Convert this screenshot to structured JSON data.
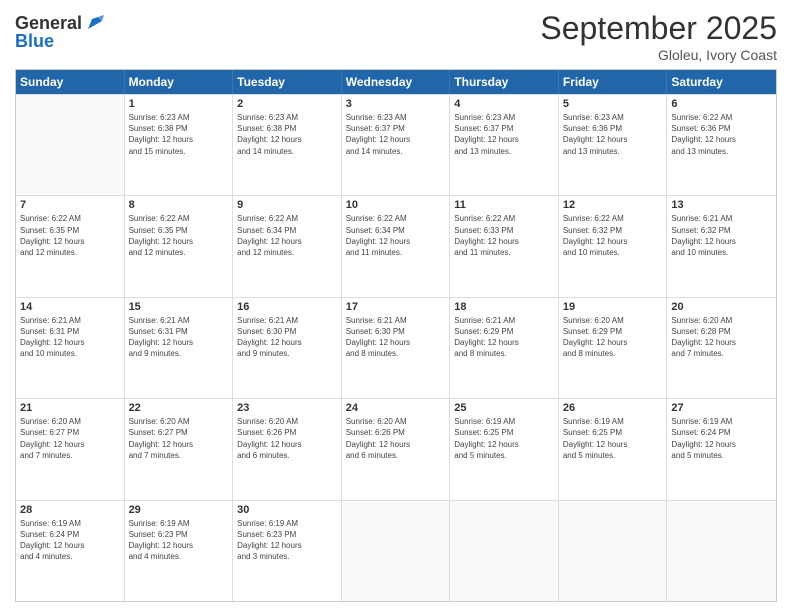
{
  "header": {
    "logo_general": "General",
    "logo_blue": "Blue",
    "month": "September 2025",
    "location": "Gloleu, Ivory Coast"
  },
  "weekdays": [
    "Sunday",
    "Monday",
    "Tuesday",
    "Wednesday",
    "Thursday",
    "Friday",
    "Saturday"
  ],
  "rows": [
    [
      {
        "day": "",
        "info": ""
      },
      {
        "day": "1",
        "info": "Sunrise: 6:23 AM\nSunset: 6:38 PM\nDaylight: 12 hours\nand 15 minutes."
      },
      {
        "day": "2",
        "info": "Sunrise: 6:23 AM\nSunset: 6:38 PM\nDaylight: 12 hours\nand 14 minutes."
      },
      {
        "day": "3",
        "info": "Sunrise: 6:23 AM\nSunset: 6:37 PM\nDaylight: 12 hours\nand 14 minutes."
      },
      {
        "day": "4",
        "info": "Sunrise: 6:23 AM\nSunset: 6:37 PM\nDaylight: 12 hours\nand 13 minutes."
      },
      {
        "day": "5",
        "info": "Sunrise: 6:23 AM\nSunset: 6:36 PM\nDaylight: 12 hours\nand 13 minutes."
      },
      {
        "day": "6",
        "info": "Sunrise: 6:22 AM\nSunset: 6:36 PM\nDaylight: 12 hours\nand 13 minutes."
      }
    ],
    [
      {
        "day": "7",
        "info": "Sunrise: 6:22 AM\nSunset: 6:35 PM\nDaylight: 12 hours\nand 12 minutes."
      },
      {
        "day": "8",
        "info": "Sunrise: 6:22 AM\nSunset: 6:35 PM\nDaylight: 12 hours\nand 12 minutes."
      },
      {
        "day": "9",
        "info": "Sunrise: 6:22 AM\nSunset: 6:34 PM\nDaylight: 12 hours\nand 12 minutes."
      },
      {
        "day": "10",
        "info": "Sunrise: 6:22 AM\nSunset: 6:34 PM\nDaylight: 12 hours\nand 11 minutes."
      },
      {
        "day": "11",
        "info": "Sunrise: 6:22 AM\nSunset: 6:33 PM\nDaylight: 12 hours\nand 11 minutes."
      },
      {
        "day": "12",
        "info": "Sunrise: 6:22 AM\nSunset: 6:32 PM\nDaylight: 12 hours\nand 10 minutes."
      },
      {
        "day": "13",
        "info": "Sunrise: 6:21 AM\nSunset: 6:32 PM\nDaylight: 12 hours\nand 10 minutes."
      }
    ],
    [
      {
        "day": "14",
        "info": "Sunrise: 6:21 AM\nSunset: 6:31 PM\nDaylight: 12 hours\nand 10 minutes."
      },
      {
        "day": "15",
        "info": "Sunrise: 6:21 AM\nSunset: 6:31 PM\nDaylight: 12 hours\nand 9 minutes."
      },
      {
        "day": "16",
        "info": "Sunrise: 6:21 AM\nSunset: 6:30 PM\nDaylight: 12 hours\nand 9 minutes."
      },
      {
        "day": "17",
        "info": "Sunrise: 6:21 AM\nSunset: 6:30 PM\nDaylight: 12 hours\nand 8 minutes."
      },
      {
        "day": "18",
        "info": "Sunrise: 6:21 AM\nSunset: 6:29 PM\nDaylight: 12 hours\nand 8 minutes."
      },
      {
        "day": "19",
        "info": "Sunrise: 6:20 AM\nSunset: 6:29 PM\nDaylight: 12 hours\nand 8 minutes."
      },
      {
        "day": "20",
        "info": "Sunrise: 6:20 AM\nSunset: 6:28 PM\nDaylight: 12 hours\nand 7 minutes."
      }
    ],
    [
      {
        "day": "21",
        "info": "Sunrise: 6:20 AM\nSunset: 6:27 PM\nDaylight: 12 hours\nand 7 minutes."
      },
      {
        "day": "22",
        "info": "Sunrise: 6:20 AM\nSunset: 6:27 PM\nDaylight: 12 hours\nand 7 minutes."
      },
      {
        "day": "23",
        "info": "Sunrise: 6:20 AM\nSunset: 6:26 PM\nDaylight: 12 hours\nand 6 minutes."
      },
      {
        "day": "24",
        "info": "Sunrise: 6:20 AM\nSunset: 6:26 PM\nDaylight: 12 hours\nand 6 minutes."
      },
      {
        "day": "25",
        "info": "Sunrise: 6:19 AM\nSunset: 6:25 PM\nDaylight: 12 hours\nand 5 minutes."
      },
      {
        "day": "26",
        "info": "Sunrise: 6:19 AM\nSunset: 6:25 PM\nDaylight: 12 hours\nand 5 minutes."
      },
      {
        "day": "27",
        "info": "Sunrise: 6:19 AM\nSunset: 6:24 PM\nDaylight: 12 hours\nand 5 minutes."
      }
    ],
    [
      {
        "day": "28",
        "info": "Sunrise: 6:19 AM\nSunset: 6:24 PM\nDaylight: 12 hours\nand 4 minutes."
      },
      {
        "day": "29",
        "info": "Sunrise: 6:19 AM\nSunset: 6:23 PM\nDaylight: 12 hours\nand 4 minutes."
      },
      {
        "day": "30",
        "info": "Sunrise: 6:19 AM\nSunset: 6:23 PM\nDaylight: 12 hours\nand 3 minutes."
      },
      {
        "day": "",
        "info": ""
      },
      {
        "day": "",
        "info": ""
      },
      {
        "day": "",
        "info": ""
      },
      {
        "day": "",
        "info": ""
      }
    ]
  ]
}
